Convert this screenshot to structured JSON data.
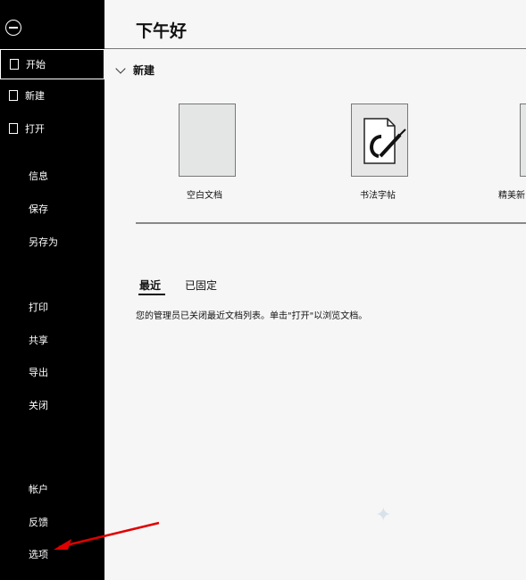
{
  "sidebar": {
    "nav": [
      {
        "label": "开始",
        "icon": "home-icon",
        "selected": true
      },
      {
        "label": "新建",
        "icon": "new-doc-icon"
      },
      {
        "label": "打开",
        "icon": "folder-open-icon"
      }
    ],
    "items": [
      "信息",
      "保存",
      "另存为",
      "打印",
      "共享",
      "导出",
      "关闭",
      "帐户",
      "反馈",
      "选项"
    ]
  },
  "main": {
    "greeting": "下午好",
    "new_section": "新建",
    "templates": [
      {
        "label": "空白文档"
      },
      {
        "label": "书法字帖"
      },
      {
        "label": "精美新"
      }
    ],
    "tabs": [
      "最近",
      "已固定"
    ],
    "message": "您的管理员已关闭最近文档列表。单击\"打开\"以浏览文档。"
  },
  "colors": {
    "sidebar_bg": "#000000",
    "accent": "#ff0000"
  }
}
